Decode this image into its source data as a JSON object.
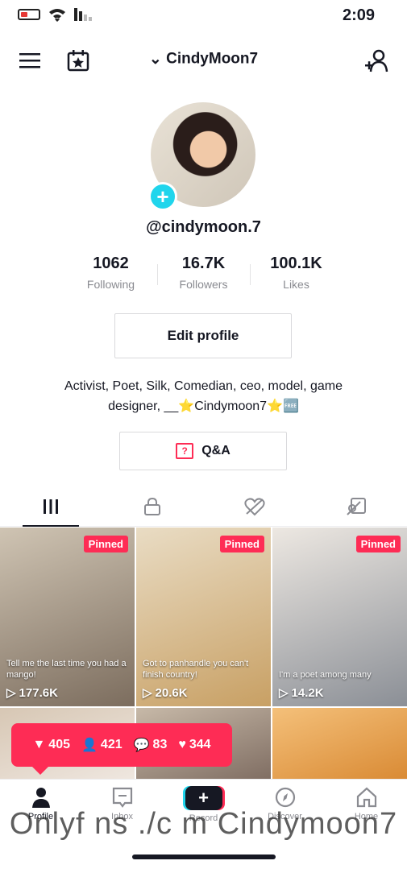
{
  "status_bar": {
    "time": "2:09"
  },
  "header": {
    "account_name": "CindyMoon7"
  },
  "profile": {
    "username": "@cindymoon.7",
    "stats": [
      {
        "value": "1062",
        "label": "Following"
      },
      {
        "value": "16.7K",
        "label": "Followers"
      },
      {
        "value": "100.1K",
        "label": "Likes"
      }
    ],
    "edit_label": "Edit profile",
    "bio_line1": "Activist, Poet, Silk, Comedian, ceo, model, game",
    "bio_line2": "designer, __⭐Cindymoon7⭐🆓",
    "qa_label": "Q&A",
    "qa_icon_text": "?"
  },
  "tabs": [
    {
      "icon": "grid-icon"
    },
    {
      "icon": "lock-icon"
    },
    {
      "icon": "liked-icon"
    },
    {
      "icon": "tagged-icon"
    }
  ],
  "videos": [
    {
      "pinned": "Pinned",
      "views": "177.6K",
      "caption": "Tell me the last time you had a mango!",
      "colors": [
        "#7c6d5e",
        "#cfc4b3"
      ]
    },
    {
      "pinned": "Pinned",
      "views": "20.6K",
      "caption": "Got to panhandle you can't finish country!",
      "colors": [
        "#c8a064",
        "#e9dcc4"
      ]
    },
    {
      "pinned": "Pinned",
      "views": "14.2K",
      "caption": "I'm a poet among many",
      "colors": [
        "#8b8f96",
        "#ede8e2"
      ]
    },
    {
      "colors": [
        "#efe7e0",
        "#d7c7b4"
      ]
    },
    {
      "colors": [
        "#7f6d62",
        "#c7b9a8"
      ]
    },
    {
      "colors": [
        "#d98a34",
        "#f4c07a"
      ]
    }
  ],
  "notification": {
    "likes": "344",
    "comments": "83",
    "followers": "421",
    "mentions": "405"
  },
  "bottom_nav": [
    {
      "label": "Home",
      "icon": "home-icon"
    },
    {
      "label": "Discover",
      "icon": "compass-icon"
    },
    {
      "label": "Record",
      "icon": "plus-icon"
    },
    {
      "label": "Inbox",
      "icon": "inbox-icon"
    },
    {
      "label": "Profile",
      "icon": "person-icon"
    }
  ],
  "watermark": "Onlyf ns ./c m Cindymoon7",
  "colors": {
    "accent": "#fe2c55",
    "secondary": "#20d5ec",
    "text": "#161823"
  }
}
